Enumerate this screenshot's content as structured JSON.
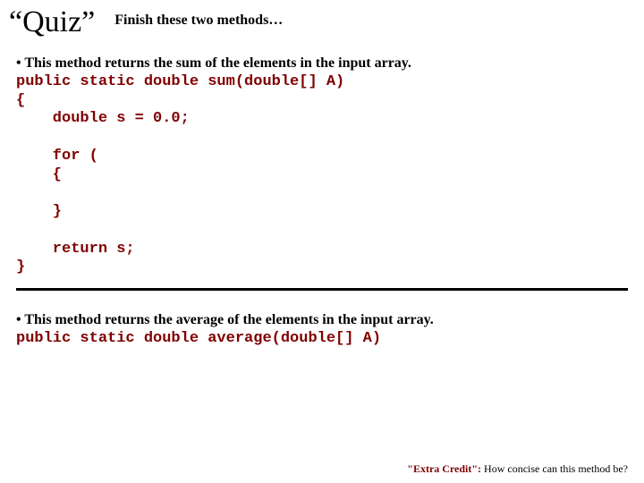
{
  "header": {
    "title": "“Quiz”",
    "subtitle": "Finish these two methods…"
  },
  "section1": {
    "bullet": "• This method returns the sum of the elements in the input array.",
    "code": "public static double sum(double[] A)\n{\n    double s = 0.0;\n\n    for (\n    {\n\n    }\n\n    return s;\n}"
  },
  "section2": {
    "bullet": "• This method returns the average of the elements in the input array.",
    "code": "public static double average(double[] A)"
  },
  "footer": {
    "label": "\"Extra Credit\":",
    "text": "  How concise can this method be?"
  }
}
